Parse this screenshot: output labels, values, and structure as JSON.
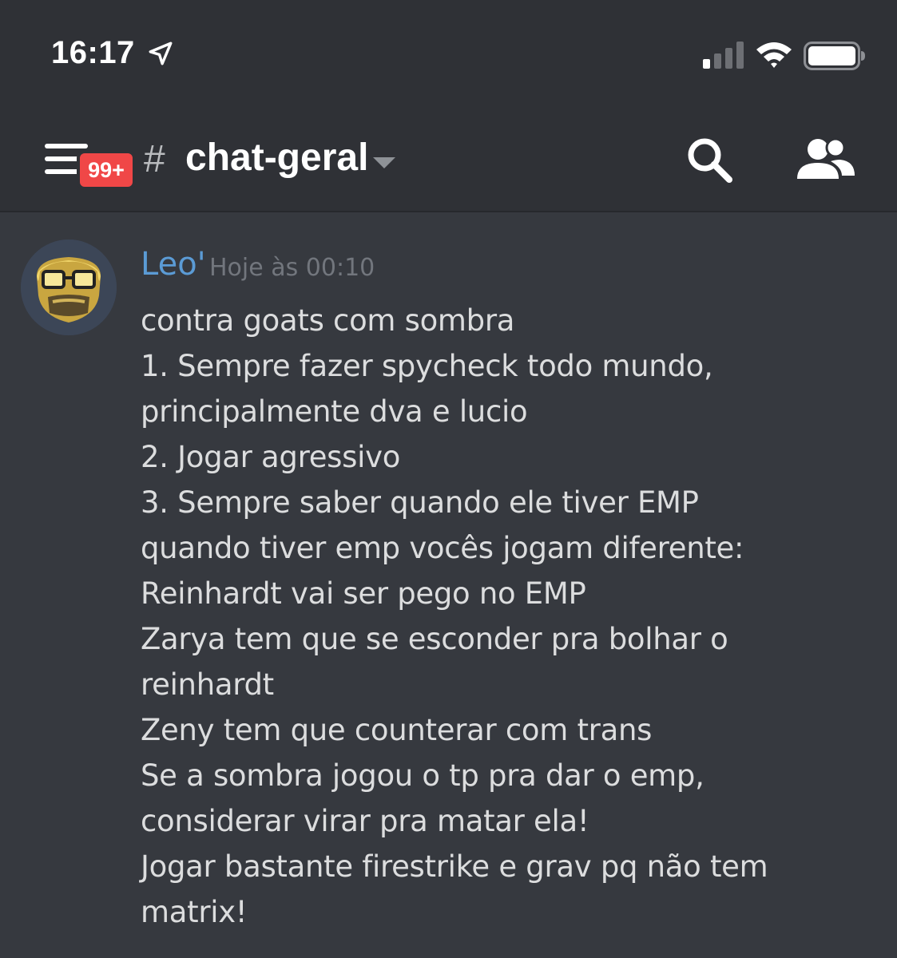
{
  "status_bar": {
    "time": "16:17",
    "icons": [
      "location-arrow-icon",
      "cellular-signal-icon",
      "wifi-icon",
      "battery-icon"
    ]
  },
  "header": {
    "menu_icon": "hamburger-menu-icon",
    "unread_badge": "99+",
    "channel_prefix": "#",
    "channel_name": "chat-geral",
    "dropdown_icon": "chevron-down-icon",
    "search_icon": "search-icon",
    "members_icon": "members-icon"
  },
  "message": {
    "author": "Leo'",
    "timestamp": "Hoje às 00:10",
    "avatar_icon": "avatar-image",
    "lines": [
      "contra goats com sombra",
      "1. Sempre fazer spycheck todo mundo,",
      "principalmente dva e lucio",
      "2. Jogar agressivo",
      "3. Sempre saber quando ele tiver EMP",
      "quando tiver emp vocês jogam diferente:",
      "Reinhardt vai ser pego no EMP",
      "Zarya tem que se esconder pra bolhar o",
      "reinhardt",
      "Zeny tem que counterar com trans",
      "Se a sombra jogou o tp pra dar o emp,",
      "considerar virar pra matar ela!",
      "Jogar bastante firestrike e grav pq não tem",
      "matrix!"
    ]
  },
  "colors": {
    "background": "#36393f",
    "header_background": "#2f3136",
    "author_color": "#5b9bd5",
    "badge_color": "#f04747",
    "text_color": "#dcddde",
    "timestamp_color": "#72767d"
  }
}
